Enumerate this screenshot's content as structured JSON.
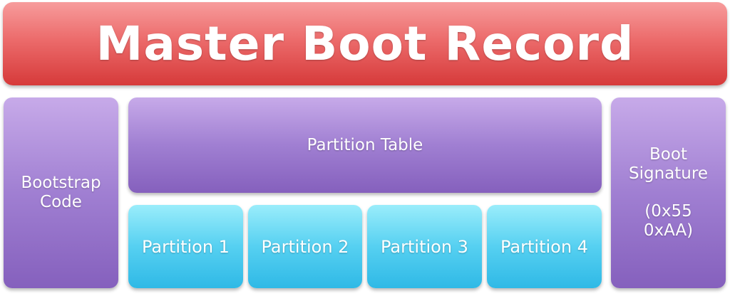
{
  "title": "Master Boot Record",
  "bootstrap": {
    "line1": "Bootstrap",
    "line2": "Code"
  },
  "partition_table": "Partition Table",
  "partitions": [
    "Partition 1",
    "Partition 2",
    "Partition 3",
    "Partition 4"
  ],
  "boot_signature": {
    "line1": "Boot",
    "line2": "Signature",
    "line3": "(0x55",
    "line4": "0xAA)"
  },
  "colors": {
    "title": "#e25555",
    "purple_sections": "#9f7fd1",
    "partitions": "#54cff0"
  }
}
